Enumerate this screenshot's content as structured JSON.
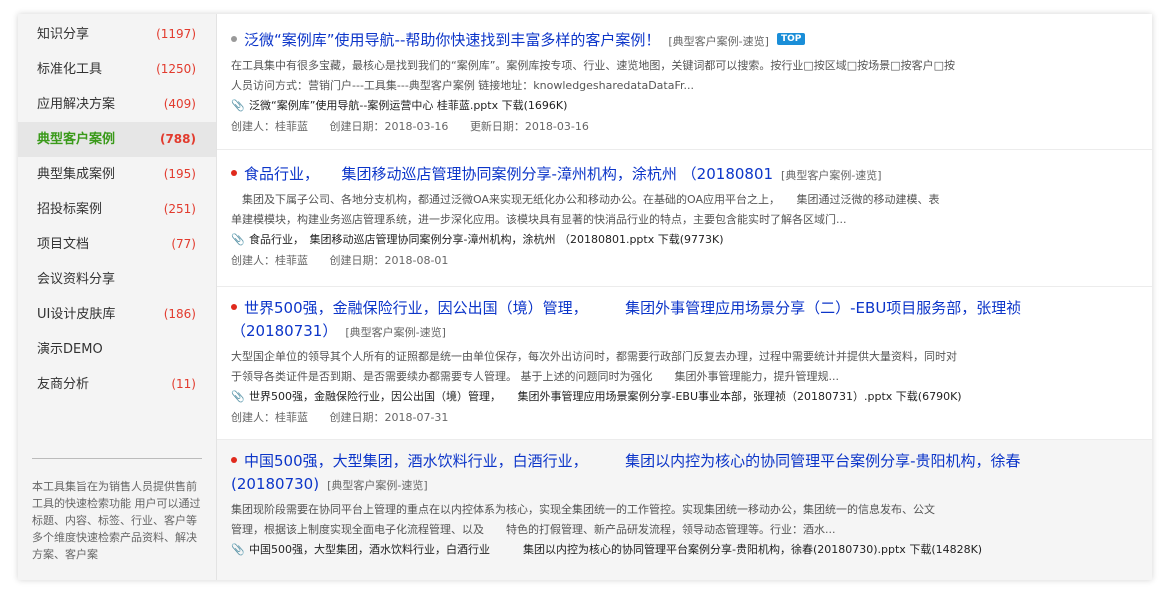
{
  "sidebar": {
    "items": [
      {
        "label": "知识分享",
        "count": "(1197)"
      },
      {
        "label": "标准化工具",
        "count": "(1250)"
      },
      {
        "label": "应用解决方案",
        "count": "(409)"
      },
      {
        "label": "典型客户案例",
        "count": "(788)"
      },
      {
        "label": "典型集成案例",
        "count": "(195)"
      },
      {
        "label": "招投标案例",
        "count": "(251)"
      },
      {
        "label": "项目文档",
        "count": "(77)"
      },
      {
        "label": "会议资料分享",
        "count": ""
      },
      {
        "label": "UI设计皮肤库",
        "count": "(186)"
      },
      {
        "label": "演示DEMO",
        "count": ""
      },
      {
        "label": "友商分析",
        "count": "(11)"
      }
    ],
    "active_index": 3,
    "description": "本工具集旨在为销售人员提供售前工具的快速检索功能 用户可以通过标题、内容、标签、行业、客户等多个维度快速检索产品资料、解决方案、客户案"
  },
  "results": [
    {
      "title": "泛微“案例库”使用导航--帮助你快速找到丰富多样的客户案例！",
      "tag": "[典型客户案例-速览]",
      "badge": "TOP",
      "summary_1": "在工具集中有很多宝藏，最核心是找到我们的“案例库”。案例库按专项、行业、速览地图，关键词都可以搜索。按行业□按区域□按场景□按客户□按",
      "summary_2": "人员访问方式：营销门户---工具集---典型客户案例 链接地址：knowledgesharedataDataFr...",
      "attachment": "泛微“案例库”使用导航--案例运营中心 桂菲蓝.pptx 下载(1696K)",
      "creator": "创建人：桂菲蓝",
      "created": "创建日期：2018-03-16",
      "updated": "更新日期：2018-03-16"
    },
    {
      "title": "食品行业，　　集团移动巡店管理协同案例分享-漳州机构，涂杭州 （20180801",
      "tag": "[典型客户案例-速览]",
      "summary_1": "　集团及下属子公司、各地分支机构，都通过泛微OA来实现无纸化办公和移动办公。在基础的OA应用平台之上，　　集团通过泛微的移动建模、表",
      "summary_2": "单建模模块，构建业务巡店管理系统，进一步深化应用。该模块具有显著的快消品行业的特点，主要包含能实时了解各区域门...",
      "attachment": "食品行业，　集团移动巡店管理协同案例分享-漳州机构，涂杭州 （20180801.pptx 下载(9773K)",
      "creator": "创建人：桂菲蓝",
      "created": "创建日期：2018-08-01"
    },
    {
      "title": "世界500强，金融保险行业，因公出国（境）管理，　　　集团外事管理应用场景分享（二）-EBU项目服务部，张理祯",
      "title_2": "（20180731）",
      "tag": "[典型客户案例-速览]",
      "summary_1": "大型国企单位的领导其个人所有的证照都是统一由单位保存，每次外出访问时，都需要行政部门反复去办理，过程中需要统计并提供大量资料，同时对",
      "summary_2": "于领导各类证件是否到期、是否需要续办都需要专人管理。 基于上述的问题同时为强化　　集团外事管理能力，提升管理规...",
      "attachment": "世界500强，金融保险行业，因公出国（境）管理，　　集团外事管理应用场景案例分享-EBU事业本部，张理祯（20180731）.pptx 下载(6790K)",
      "creator": "创建人：桂菲蓝",
      "created": "创建日期：2018-07-31"
    },
    {
      "title": "中国500强，大型集团，酒水饮料行业，白酒行业，　　　集团以内控为核心的协同管理平台案例分享-贵阳机构，徐春",
      "title_2": "(20180730)",
      "tag": "[典型客户案例-速览]",
      "summary_1": "集团现阶段需要在协同平台上管理的重点在以内控体系为核心，实现全集团统一的工作管控。实现集团统一移动办公，集团统一的信息发布、公文",
      "summary_2": "管理，根据该上制度实现全面电子化流程管理、以及　　特色的打假管理、新产品研发流程，领导动态管理等。行业：酒水...",
      "attachment": "中国500强，大型集团，酒水饮料行业，白酒行业　　　集团以内控为核心的协同管理平台案例分享-贵阳机构，徐春(20180730).pptx 下载(14828K)"
    }
  ],
  "icons": {
    "attachment": "paperclip-icon",
    "bullet": "bullet-dot-icon"
  },
  "colors": {
    "link": "#0c35c9",
    "count": "#e23b2e",
    "active": "#3a9a1a",
    "badge": "#1a8ed8"
  }
}
